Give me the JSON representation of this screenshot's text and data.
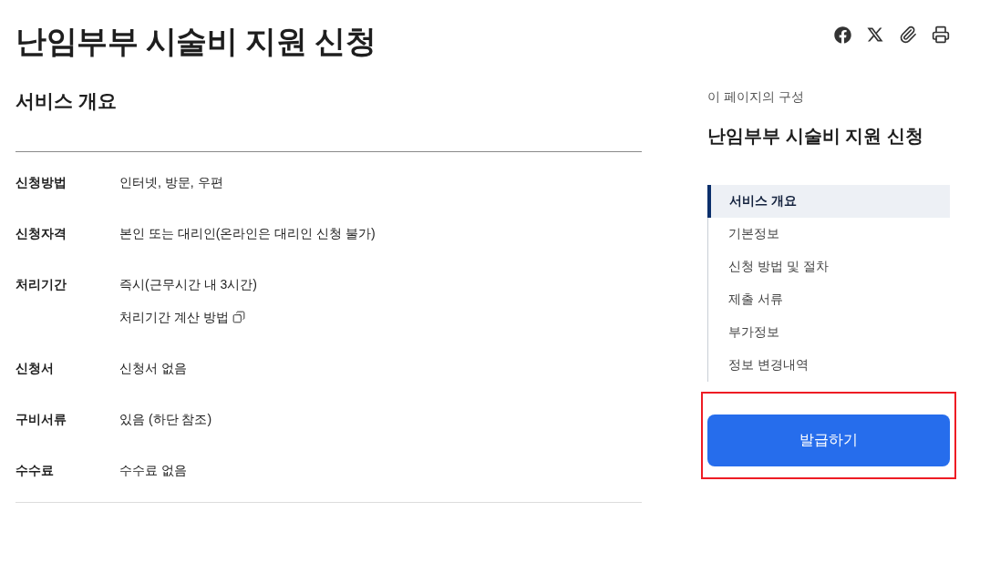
{
  "page": {
    "title": "난임부부 시술비 지원 신청"
  },
  "overview": {
    "heading": "서비스 개요",
    "rows": [
      {
        "label": "신청방법",
        "values": [
          {
            "kind": "text",
            "text": "인터넷, 방문, 우편"
          }
        ]
      },
      {
        "label": "신청자격",
        "values": [
          {
            "kind": "text",
            "text": "본인 또는 대리인(온라인은 대리인 신청 불가)"
          }
        ]
      },
      {
        "label": "처리기간",
        "values": [
          {
            "kind": "text",
            "text": "즉시(근무시간 내 3시간)"
          },
          {
            "kind": "link",
            "text": "처리기간 계산 방법"
          }
        ]
      },
      {
        "label": "신청서",
        "values": [
          {
            "kind": "text",
            "text": "신청서 없음"
          }
        ]
      },
      {
        "label": "구비서류",
        "values": [
          {
            "kind": "text",
            "text": "있음 (하단 참조)"
          }
        ]
      },
      {
        "label": "수수료",
        "values": [
          {
            "kind": "text",
            "text": "수수료 없음"
          }
        ]
      }
    ]
  },
  "toc": {
    "caption": "이 페이지의 구성",
    "title": "난임부부 시술비 지원 신청",
    "items": [
      {
        "label": "서비스 개요",
        "selected": true
      },
      {
        "label": "기본정보",
        "selected": false
      },
      {
        "label": "신청 방법 및 절차",
        "selected": false
      },
      {
        "label": "제출 서류",
        "selected": false
      },
      {
        "label": "부가정보",
        "selected": false
      },
      {
        "label": "정보 변경내역",
        "selected": false
      }
    ]
  },
  "action_button": {
    "label": "발급하기",
    "highlighted": true
  }
}
